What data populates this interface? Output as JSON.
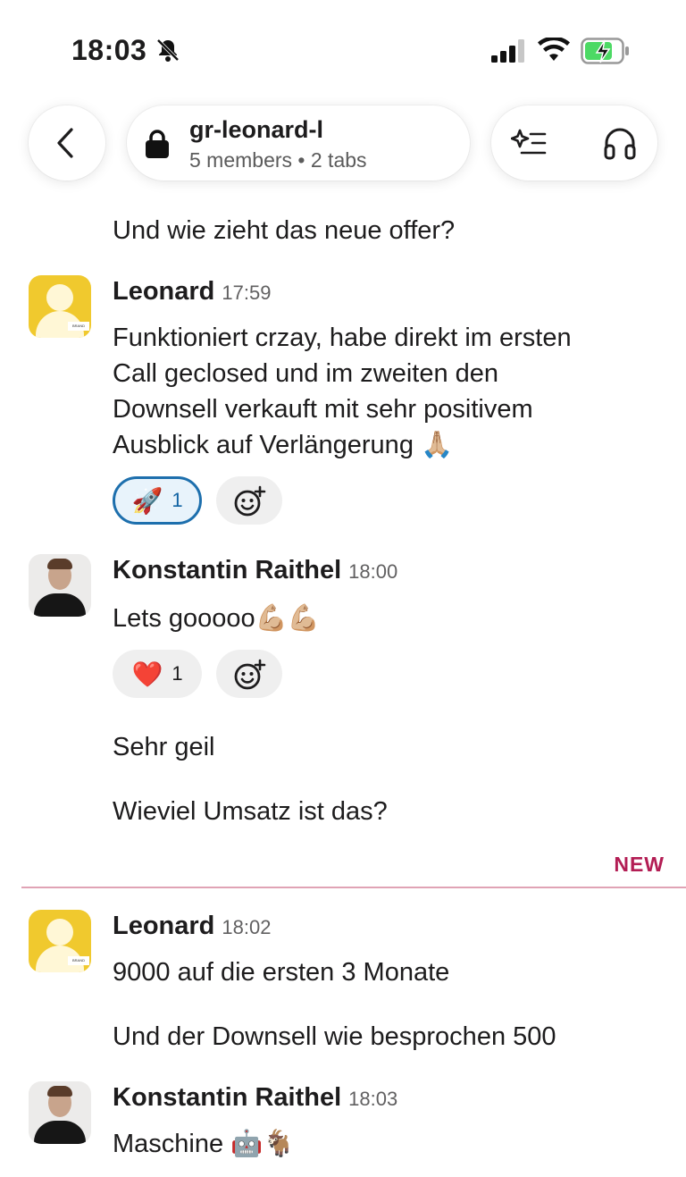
{
  "status_bar": {
    "time": "18:03"
  },
  "header": {
    "channel_name": "gr-leonard-l",
    "channel_meta": "5 members • 2 tabs"
  },
  "messages": [
    {
      "text": "Und wie zieht das neue offer?"
    },
    {
      "sender": "Leonard",
      "time": "17:59",
      "lines": [
        "Funktioniert crzay, habe direkt im ersten",
        "Call geclosed und im zweiten den",
        "Downsell verkauft mit sehr positivem",
        "Ausblick auf Verlängerung 🙏🏼"
      ],
      "reaction": {
        "emoji": "🚀",
        "count": "1"
      }
    },
    {
      "sender": "Konstantin Raithel",
      "time": "18:00",
      "text": "Lets gooooo💪🏼💪🏼",
      "reaction": {
        "emoji": "❤️",
        "count": "1"
      }
    },
    {
      "text": "Sehr geil"
    },
    {
      "text": "Wieviel Umsatz ist das?"
    },
    {
      "sender": "Leonard",
      "time": "18:02",
      "text": "9000 auf die ersten 3 Monate"
    },
    {
      "text": "Und der Downsell wie besprochen 500"
    },
    {
      "sender": "Konstantin Raithel",
      "time": "18:03",
      "text": "Maschine 🤖🐐"
    }
  ],
  "divider": {
    "label": "NEW"
  },
  "icons": {
    "back": "chevron-left-icon",
    "lock": "lock-icon",
    "ai": "sparkle-list-icon",
    "huddle": "headphones-icon",
    "add_reaction": "add-emoji-icon",
    "mute": "bell-slash-icon"
  },
  "colors": {
    "new_divider": "#b31d54",
    "active_reaction_border": "#1d6fad",
    "avatar_leonard": "#f0c92e"
  }
}
